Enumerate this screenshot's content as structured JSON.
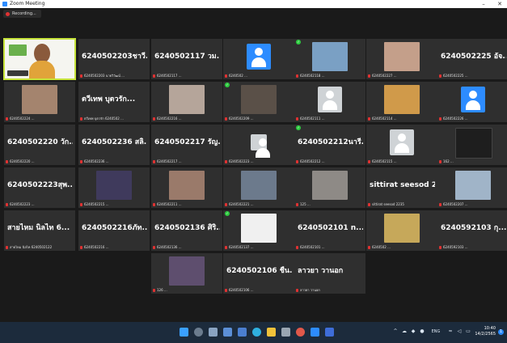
{
  "window": {
    "title": "Zoom Meeting",
    "minimize": "–",
    "close": "✕"
  },
  "recording": {
    "label": "Recording..."
  },
  "tiles": [
    {
      "label": ""
    },
    {
      "big": "6240502203ชาวี...",
      "label": "6240502203 นายวิวัฒน์ ..."
    },
    {
      "big": "6240502117 วม...",
      "label": "6240502117 ..."
    },
    {
      "label": "6240502 ..."
    },
    {
      "label": "6240502118 ..."
    },
    {
      "label": "6240502227 ..."
    },
    {
      "big": "6240502225 อัจ...",
      "label": "6240502225 ..."
    },
    {
      "label": "6240502224 ..."
    },
    {
      "big": "ตวีเทพ บุตวรัก...",
      "label": "ตวีเทพ บุตวรัก 6240502 ..."
    },
    {
      "label": "6240502216 ..."
    },
    {
      "label": "6240502209 ..."
    },
    {
      "label": "6240502111 ..."
    },
    {
      "label": "6240502114 ..."
    },
    {
      "label": "6240502226 ..."
    },
    {
      "big": "6240502220 วัก...",
      "label": "6240502220 ..."
    },
    {
      "big": "6240502236 สลิ...",
      "label": "6240502236 ..."
    },
    {
      "big": "6240502217 รัญ...",
      "label": "6240502217 ..."
    },
    {
      "label": "6240502223 ..."
    },
    {
      "big": "6240502212นารี...",
      "label": "6240502212 ..."
    },
    {
      "label": "6240502115 ..."
    },
    {
      "label": "162 ..."
    },
    {
      "big": "6240502223สุพ...",
      "label": "6240502223 ..."
    },
    {
      "label": "6240502215 ..."
    },
    {
      "label": "6240502211 ..."
    },
    {
      "label": "6240502221 ..."
    },
    {
      "label": "125 ..."
    },
    {
      "big": "sittirat seesod 2...",
      "label": "sittirat seesod 2235"
    },
    {
      "label": "6240502207 ..."
    },
    {
      "big": "สายไหม นิลไท 6...",
      "label": "สายไหม นิลไท 6240502122"
    },
    {
      "big": "6240502216ภัท...",
      "label": "6240502216 ..."
    },
    {
      "big": "6240502136 ศิริ...",
      "label": "6240502136 ..."
    },
    {
      "label": "6240502137 ..."
    },
    {
      "big": "6240502101 n...",
      "label": "6240502101 ..."
    },
    {
      "label": "6240502 ..."
    },
    {
      "big": "6240592103 กุ...",
      "label": "6240592103 ..."
    },
    {
      "label": "126 ..."
    },
    {
      "big": "6240502106 ชื่น...",
      "label": "6240502106 ..."
    },
    {
      "big": "ลาวยา วานอก",
      "label": "ลาวยา วานอก"
    }
  ],
  "colors": {
    "photo1": "#7aa0c4",
    "photo2": "#c49f8a",
    "photo3": "#a4846e",
    "photo4": "#5a5048",
    "photo5": "#b08c60",
    "photo6": "#d09a4a",
    "photo7": "#b5a59a",
    "photo8": "#1e1e1e",
    "photo9": "#3f3a5c",
    "photo10": "#9a7a6a",
    "photo11": "#6c7a8c",
    "photo12": "#8e8a86",
    "photo13": "#a0b4c8",
    "photo14": "#c6a85a",
    "photo15": "#5e4e6e"
  },
  "taskbar": {
    "time": "10:40",
    "date": "14/2/2565",
    "lang": "ENG",
    "notif": "1"
  }
}
